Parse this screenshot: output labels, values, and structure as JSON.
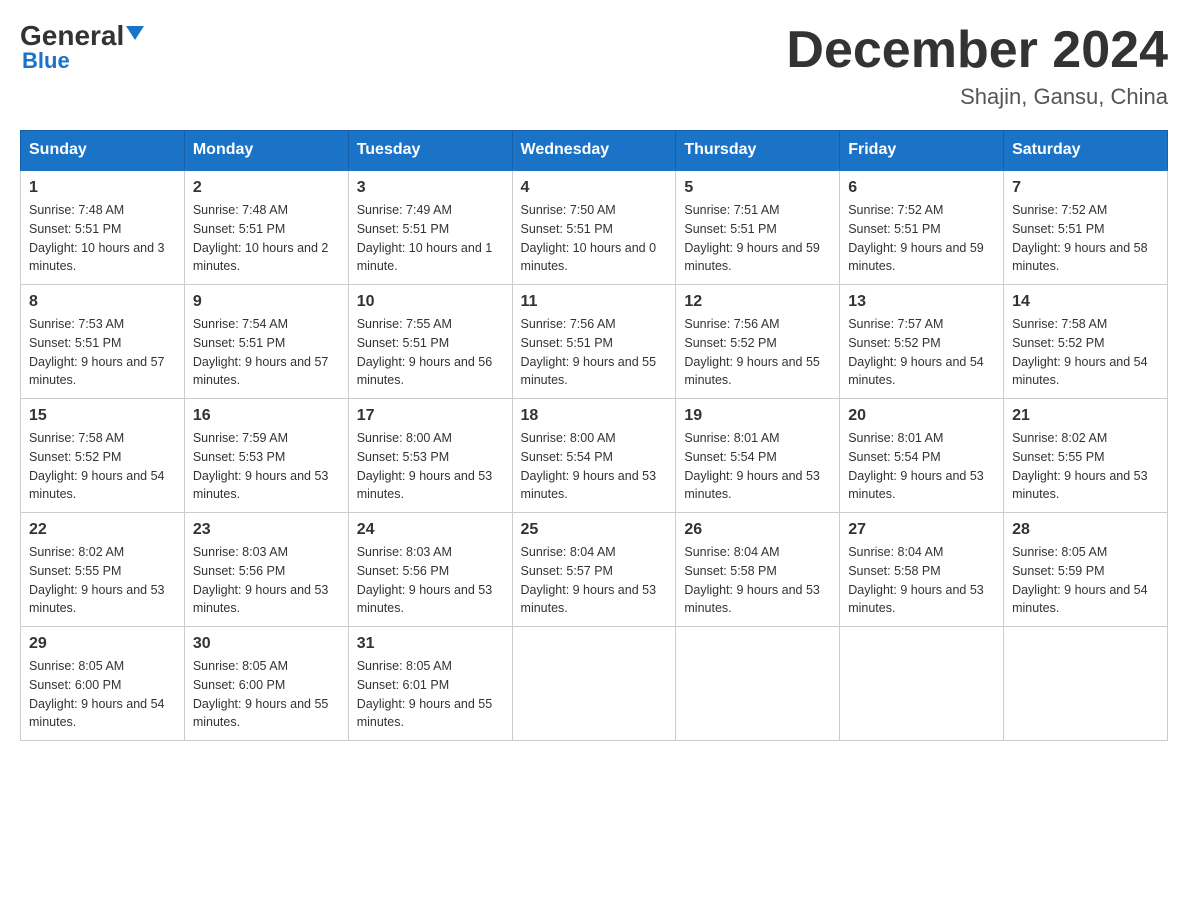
{
  "logo": {
    "general": "General",
    "blue": "Blue"
  },
  "title": "December 2024",
  "location": "Shajin, Gansu, China",
  "days_of_week": [
    "Sunday",
    "Monday",
    "Tuesday",
    "Wednesday",
    "Thursday",
    "Friday",
    "Saturday"
  ],
  "weeks": [
    [
      {
        "day": "1",
        "sunrise": "7:48 AM",
        "sunset": "5:51 PM",
        "daylight": "10 hours and 3 minutes."
      },
      {
        "day": "2",
        "sunrise": "7:48 AM",
        "sunset": "5:51 PM",
        "daylight": "10 hours and 2 minutes."
      },
      {
        "day": "3",
        "sunrise": "7:49 AM",
        "sunset": "5:51 PM",
        "daylight": "10 hours and 1 minute."
      },
      {
        "day": "4",
        "sunrise": "7:50 AM",
        "sunset": "5:51 PM",
        "daylight": "10 hours and 0 minutes."
      },
      {
        "day": "5",
        "sunrise": "7:51 AM",
        "sunset": "5:51 PM",
        "daylight": "9 hours and 59 minutes."
      },
      {
        "day": "6",
        "sunrise": "7:52 AM",
        "sunset": "5:51 PM",
        "daylight": "9 hours and 59 minutes."
      },
      {
        "day": "7",
        "sunrise": "7:52 AM",
        "sunset": "5:51 PM",
        "daylight": "9 hours and 58 minutes."
      }
    ],
    [
      {
        "day": "8",
        "sunrise": "7:53 AM",
        "sunset": "5:51 PM",
        "daylight": "9 hours and 57 minutes."
      },
      {
        "day": "9",
        "sunrise": "7:54 AM",
        "sunset": "5:51 PM",
        "daylight": "9 hours and 57 minutes."
      },
      {
        "day": "10",
        "sunrise": "7:55 AM",
        "sunset": "5:51 PM",
        "daylight": "9 hours and 56 minutes."
      },
      {
        "day": "11",
        "sunrise": "7:56 AM",
        "sunset": "5:51 PM",
        "daylight": "9 hours and 55 minutes."
      },
      {
        "day": "12",
        "sunrise": "7:56 AM",
        "sunset": "5:52 PM",
        "daylight": "9 hours and 55 minutes."
      },
      {
        "day": "13",
        "sunrise": "7:57 AM",
        "sunset": "5:52 PM",
        "daylight": "9 hours and 54 minutes."
      },
      {
        "day": "14",
        "sunrise": "7:58 AM",
        "sunset": "5:52 PM",
        "daylight": "9 hours and 54 minutes."
      }
    ],
    [
      {
        "day": "15",
        "sunrise": "7:58 AM",
        "sunset": "5:52 PM",
        "daylight": "9 hours and 54 minutes."
      },
      {
        "day": "16",
        "sunrise": "7:59 AM",
        "sunset": "5:53 PM",
        "daylight": "9 hours and 53 minutes."
      },
      {
        "day": "17",
        "sunrise": "8:00 AM",
        "sunset": "5:53 PM",
        "daylight": "9 hours and 53 minutes."
      },
      {
        "day": "18",
        "sunrise": "8:00 AM",
        "sunset": "5:54 PM",
        "daylight": "9 hours and 53 minutes."
      },
      {
        "day": "19",
        "sunrise": "8:01 AM",
        "sunset": "5:54 PM",
        "daylight": "9 hours and 53 minutes."
      },
      {
        "day": "20",
        "sunrise": "8:01 AM",
        "sunset": "5:54 PM",
        "daylight": "9 hours and 53 minutes."
      },
      {
        "day": "21",
        "sunrise": "8:02 AM",
        "sunset": "5:55 PM",
        "daylight": "9 hours and 53 minutes."
      }
    ],
    [
      {
        "day": "22",
        "sunrise": "8:02 AM",
        "sunset": "5:55 PM",
        "daylight": "9 hours and 53 minutes."
      },
      {
        "day": "23",
        "sunrise": "8:03 AM",
        "sunset": "5:56 PM",
        "daylight": "9 hours and 53 minutes."
      },
      {
        "day": "24",
        "sunrise": "8:03 AM",
        "sunset": "5:56 PM",
        "daylight": "9 hours and 53 minutes."
      },
      {
        "day": "25",
        "sunrise": "8:04 AM",
        "sunset": "5:57 PM",
        "daylight": "9 hours and 53 minutes."
      },
      {
        "day": "26",
        "sunrise": "8:04 AM",
        "sunset": "5:58 PM",
        "daylight": "9 hours and 53 minutes."
      },
      {
        "day": "27",
        "sunrise": "8:04 AM",
        "sunset": "5:58 PM",
        "daylight": "9 hours and 53 minutes."
      },
      {
        "day": "28",
        "sunrise": "8:05 AM",
        "sunset": "5:59 PM",
        "daylight": "9 hours and 54 minutes."
      }
    ],
    [
      {
        "day": "29",
        "sunrise": "8:05 AM",
        "sunset": "6:00 PM",
        "daylight": "9 hours and 54 minutes."
      },
      {
        "day": "30",
        "sunrise": "8:05 AM",
        "sunset": "6:00 PM",
        "daylight": "9 hours and 55 minutes."
      },
      {
        "day": "31",
        "sunrise": "8:05 AM",
        "sunset": "6:01 PM",
        "daylight": "9 hours and 55 minutes."
      },
      null,
      null,
      null,
      null
    ]
  ],
  "labels": {
    "sunrise": "Sunrise:",
    "sunset": "Sunset:",
    "daylight": "Daylight:"
  }
}
